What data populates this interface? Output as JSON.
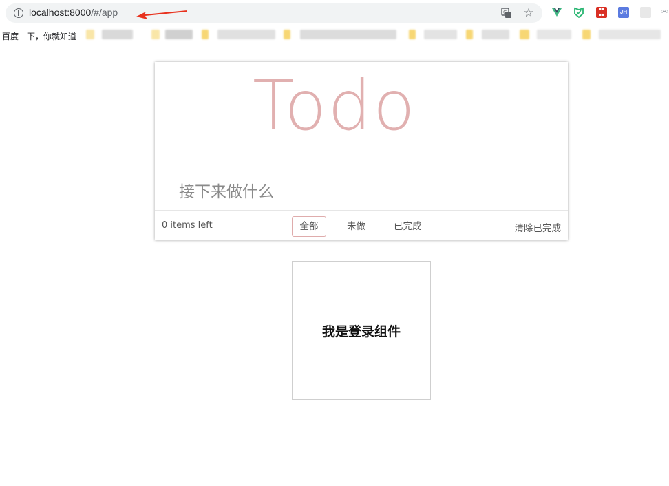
{
  "browser": {
    "url_host": "localhost:8000",
    "url_path": "/#/app",
    "bookmarks": {
      "first": "百度一下，你就知道"
    }
  },
  "colors": {
    "accent": "#af2f2f",
    "annotation_arrow": "#e8321e"
  },
  "extensions": {
    "jh_label": "JH"
  },
  "todo": {
    "title": "Todo",
    "input_placeholder": "接下来做什么",
    "items_left": "0 items left",
    "filters": {
      "all": "全部",
      "active": "未做",
      "completed": "已完成"
    },
    "active_filter": "all",
    "clear_completed": "清除已完成"
  },
  "login": {
    "text": "我是登录组件"
  }
}
